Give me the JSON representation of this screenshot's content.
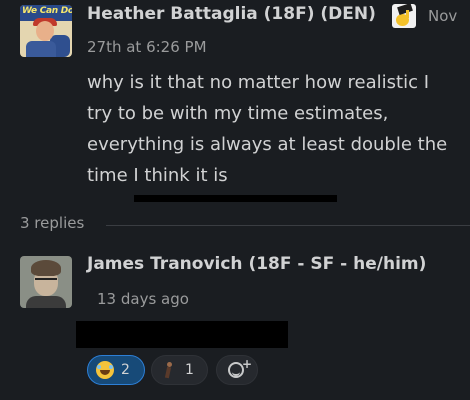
{
  "message": {
    "avatar_text": "We Can Do It!",
    "sender": "Heather Battaglia (18F) (DEN)",
    "status_emoji": "graduation-cap-emoji",
    "header_date": "Nov",
    "timestamp": "27th at 6:26 PM",
    "body": "why is it that no matter how realistic I try to be with my time estimates, everything is always at least double the time I think it is"
  },
  "thread": {
    "replies_label": "3 replies",
    "reply": {
      "sender": "James Tranovich (18F - SF - he/him)",
      "time": "13 days ago",
      "reactions": [
        {
          "icon": "joy-emoji",
          "count": "2",
          "active": true
        },
        {
          "icon": "person-walking-emoji",
          "count": "1",
          "active": false
        }
      ],
      "add_reaction_icon": "add-reaction-icon"
    }
  },
  "colors": {
    "background": "#1a1d21",
    "text": "#d1d2d3",
    "muted": "#9a9b9c",
    "active_reaction_bg": "#174a78",
    "active_reaction_border": "#2d7fd6"
  }
}
